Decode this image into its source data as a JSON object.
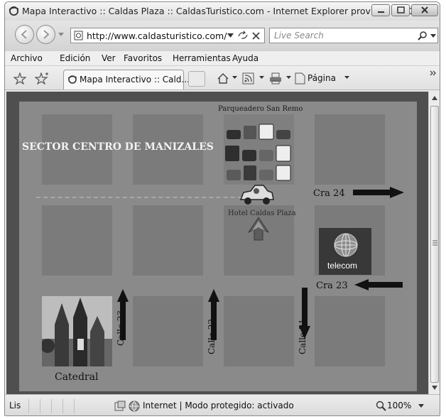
{
  "window": {
    "title": "Mapa Interactivo :: Caldas Plaza :: CaldasTuristico.com - Internet Explorer provided by Dell"
  },
  "toolbar": {
    "address": "http://www.caldasturistico.com/",
    "search_placeholder": "Live Search"
  },
  "menu": {
    "items": [
      "Archivo",
      "Edición",
      "Ver",
      "Favoritos",
      "Herramientas",
      "Ayuda"
    ]
  },
  "tabs": {
    "active_label": "Mapa Interactivo :: Cald...",
    "page_label": "Página"
  },
  "map": {
    "sector_title": "SECTOR CENTRO DE MANIZALES",
    "parking_label": "Parqueadero San Remo",
    "hotel_label": "Hotel Caldas Plaza",
    "telecom_label": "telecom",
    "cathedral_label": "Catedral",
    "streets": {
      "cra24": "Cra 24",
      "cra23": "Cra 23",
      "calle23": "Calle 23",
      "calle22": "Calle 22",
      "calle21": "Calle 21"
    }
  },
  "status": {
    "left": "Lis",
    "zone": "Internet | Modo protegido: activado",
    "zoom": "100%"
  }
}
